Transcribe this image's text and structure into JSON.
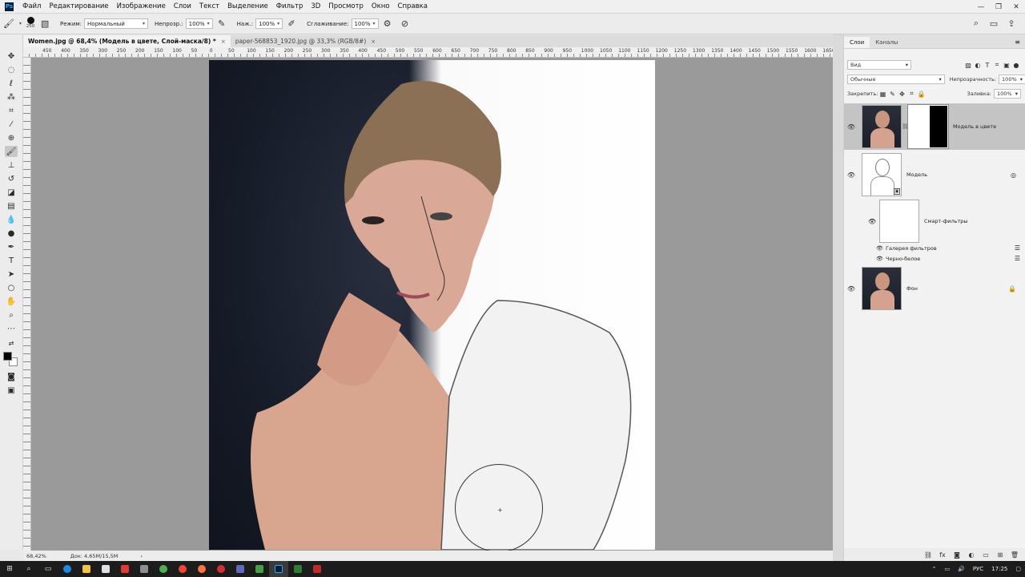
{
  "app": {
    "logo": "Ps"
  },
  "menu": [
    "Файл",
    "Редактирование",
    "Изображение",
    "Слои",
    "Текст",
    "Выделение",
    "Фильтр",
    "3D",
    "Просмотр",
    "Окно",
    "Справка"
  ],
  "window_controls": {
    "minimize": "—",
    "maximize": "❐",
    "close": "✕"
  },
  "options": {
    "brush_size": "250",
    "mode_label": "Режим:",
    "mode_value": "Нормальный",
    "opacity_label": "Непрозр.:",
    "opacity_value": "100%",
    "flow_label": "Наж.:",
    "flow_value": "100%",
    "smoothing_label": "Сглаживание:",
    "smoothing_value": "100%"
  },
  "tabs": [
    {
      "label": "Women.jpg @ 68,4% (Модель в цвете, Слой-маска/8) *",
      "close": "×"
    },
    {
      "label": "paper-568853_1920.jpg @ 33,3% (RGB/8#)",
      "close": "×"
    }
  ],
  "ruler_labels": [
    "450",
    "400",
    "350",
    "300",
    "250",
    "200",
    "150",
    "100",
    "50",
    "0",
    "50",
    "100",
    "150",
    "200",
    "250",
    "300",
    "350",
    "400",
    "450",
    "500",
    "550",
    "600",
    "650",
    "700",
    "750",
    "800",
    "850",
    "900",
    "950",
    "1000",
    "1050",
    "1100",
    "1150",
    "1200",
    "1250",
    "1300",
    "1350",
    "1400",
    "1450",
    "1500",
    "1550",
    "1600",
    "1650"
  ],
  "status": {
    "zoom": "68,42%",
    "doc": "Док: 4,65M/15,5M",
    "arrow": "›"
  },
  "panel": {
    "tabs": [
      "Слои",
      "Каналы"
    ],
    "filter": "Вид",
    "blend_mode": "Обычные",
    "opacity_label": "Непрозрачность:",
    "opacity_value": "100%",
    "lock_label": "Закрепить:",
    "fill_label": "Заливка:",
    "fill_value": "100%",
    "layers": [
      {
        "name": "Модель в цвете",
        "visible": true,
        "selected": true
      },
      {
        "name": "Модель",
        "visible": true,
        "selected": false
      },
      {
        "name": "Фон",
        "visible": true,
        "selected": false
      }
    ],
    "smart_filters_label": "Смарт-фильтры",
    "filters": [
      "Галерея фильтров",
      "Черно-белое"
    ]
  },
  "taskbar": {
    "lang": "РУС",
    "time": "17:25"
  },
  "colors": {
    "accent": "#31a8ff",
    "ps_bg": "#001e36",
    "canvas_bg": "#9a9a9a",
    "selected_layer": "#c4c4c4"
  }
}
